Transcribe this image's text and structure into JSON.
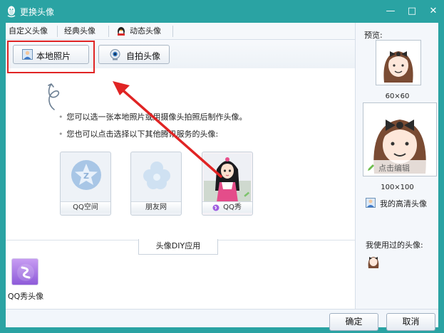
{
  "window": {
    "title": "更换头像",
    "minimize_glyph": "—",
    "maximize_glyph": "□",
    "close_glyph": "✕"
  },
  "tabs": [
    {
      "label": "自定义头像"
    },
    {
      "label": "经典头像"
    },
    {
      "label": "动态头像"
    }
  ],
  "subtabs": {
    "local_photo": "本地照片",
    "selfie": "自拍头像"
  },
  "content": {
    "line1": "您可以选一张本地照片或用摄像头拍照后制作头像。",
    "line2": "您也可以点击选择以下其他腾讯服务的头像:",
    "services": [
      {
        "label": "QQ空间",
        "icon": "qzone-icon"
      },
      {
        "label": "朋友网",
        "icon": "pengyou-icon"
      },
      {
        "label": "QQ秀",
        "icon": "qqxiu-icon"
      }
    ]
  },
  "diy": {
    "tab_label": "头像DIY应用",
    "app_label": "QQ秀头像"
  },
  "preview": {
    "label": "预览:",
    "small_size": "60×60",
    "large_size": "100×100",
    "edit_label": "点击编辑",
    "hd_label": "我的高清头像",
    "used_label": "我使用过的头像:"
  },
  "footer": {
    "ok": "确定",
    "cancel": "取消"
  },
  "colors": {
    "titlebar": "#2aa3a3",
    "highlight": "#e02424",
    "arrow": "#e02424"
  }
}
